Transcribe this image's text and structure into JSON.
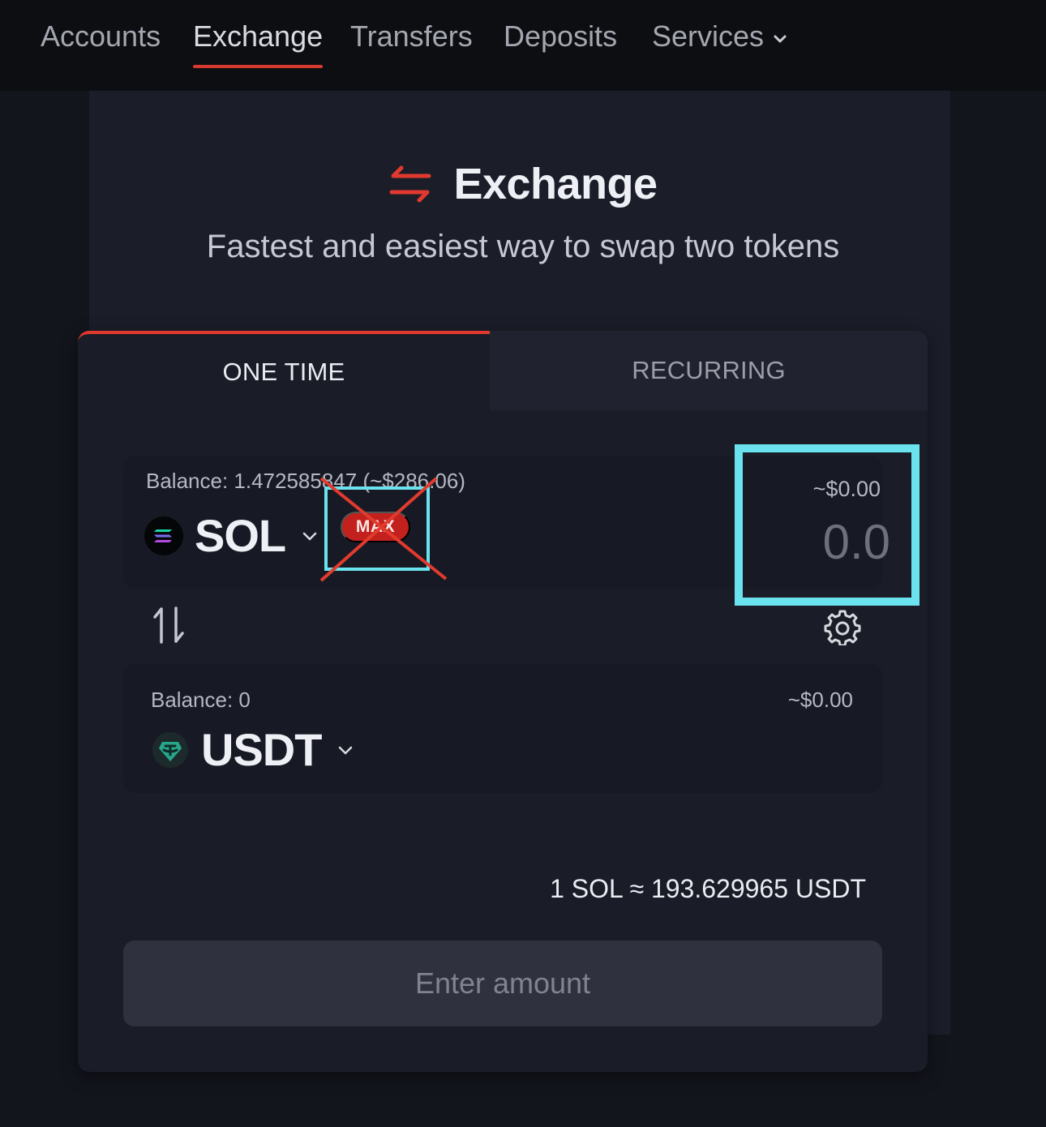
{
  "nav": {
    "items": [
      {
        "label": "Accounts"
      },
      {
        "label": "Exchange"
      },
      {
        "label": "Transfers"
      },
      {
        "label": "Deposits"
      },
      {
        "label": "Services"
      }
    ],
    "active": "Exchange"
  },
  "header": {
    "title": "Exchange",
    "subtitle": "Fastest and easiest way to swap two tokens",
    "icon": "swap-arrows-icon"
  },
  "tabs": [
    {
      "label": "ONE TIME"
    },
    {
      "label": "RECURRING"
    }
  ],
  "from": {
    "balance": "Balance: 1.472585847 (~$286.06)",
    "symbol": "SOL",
    "max_label": "MAX",
    "usd": "~$0.00",
    "amount_placeholder": "0.0"
  },
  "to": {
    "balance": "Balance: 0",
    "symbol": "USDT",
    "usd": "~$0.00"
  },
  "rate": "1 SOL ≈ 193.629965 USDT",
  "submit_label": "Enter amount",
  "colors": {
    "accent": "#e2392f",
    "highlight": "#6ae3ef",
    "background": "#13151d",
    "card": "#1a1d27"
  }
}
